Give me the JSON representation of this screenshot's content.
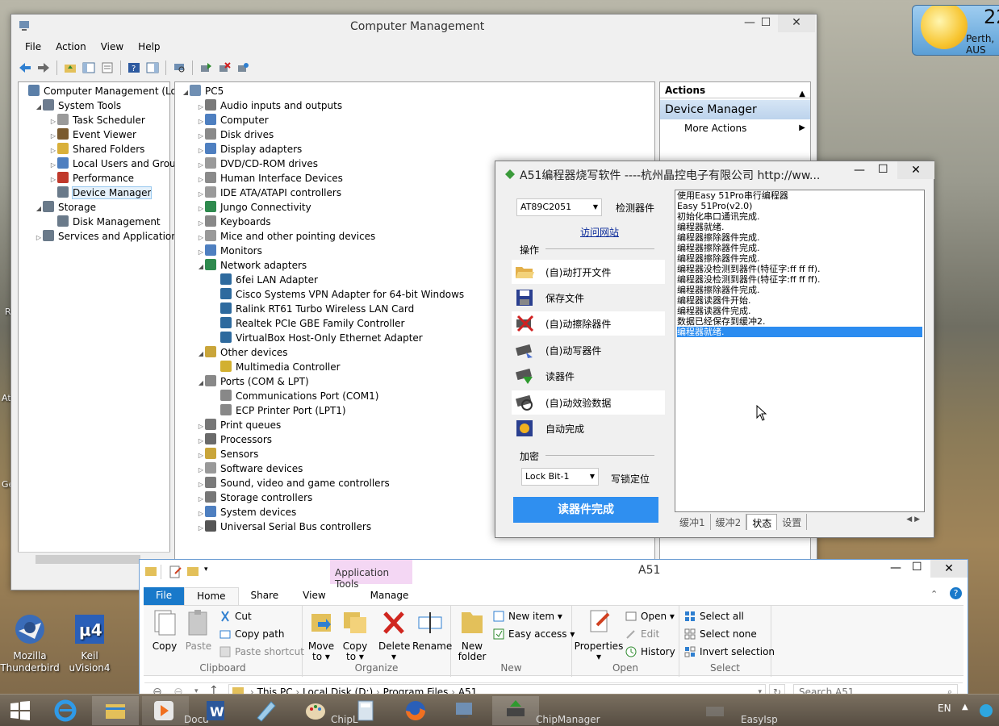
{
  "desktop": {
    "icons": [
      {
        "name": "Mozilla Thunderbird",
        "line1": "Mozilla",
        "line2": "Thunderbird"
      },
      {
        "name": "Keil uVision4",
        "line1": "Keil uVision4",
        "line2": ""
      }
    ],
    "edge_labels": [
      "R",
      "At",
      "Ge"
    ],
    "weather": {
      "temp": "22",
      "city": "Perth, AUS"
    }
  },
  "cm": {
    "title": "Computer Management",
    "menu": [
      "File",
      "Action",
      "View",
      "Help"
    ],
    "close": "✕",
    "minimize": "—",
    "maximize": "☐",
    "tree": [
      {
        "label": "Computer Management (Local",
        "level": 0,
        "tri": "",
        "icon": "#5b7fa8"
      },
      {
        "label": "System Tools",
        "level": 1,
        "tri": "◢",
        "icon": "#6d7c8f"
      },
      {
        "label": "Task Scheduler",
        "level": 2,
        "tri": "▷",
        "icon": "#9a9a9a"
      },
      {
        "label": "Event Viewer",
        "level": 2,
        "tri": "▷",
        "icon": "#7a5a2e"
      },
      {
        "label": "Shared Folders",
        "level": 2,
        "tri": "▷",
        "icon": "#d9b03a"
      },
      {
        "label": "Local Users and Groups",
        "level": 2,
        "tri": "▷",
        "icon": "#4e7fc0"
      },
      {
        "label": "Performance",
        "level": 2,
        "tri": "▷",
        "icon": "#c0392b"
      },
      {
        "label": "Device Manager",
        "level": 2,
        "tri": "",
        "icon": "#6a7a8a",
        "selected": true
      },
      {
        "label": "Storage",
        "level": 1,
        "tri": "◢",
        "icon": "#6a7a8a"
      },
      {
        "label": "Disk Management",
        "level": 2,
        "tri": "",
        "icon": "#6a7a8a"
      },
      {
        "label": "Services and Applications",
        "level": 1,
        "tri": "▷",
        "icon": "#6a7a8a"
      }
    ],
    "devices_root": "PC5",
    "devices": [
      {
        "label": "Audio inputs and outputs",
        "level": 1,
        "tri": "▷"
      },
      {
        "label": "Computer",
        "level": 1,
        "tri": "▷"
      },
      {
        "label": "Disk drives",
        "level": 1,
        "tri": "▷"
      },
      {
        "label": "Display adapters",
        "level": 1,
        "tri": "▷"
      },
      {
        "label": "DVD/CD-ROM drives",
        "level": 1,
        "tri": "▷"
      },
      {
        "label": "Human Interface Devices",
        "level": 1,
        "tri": "▷"
      },
      {
        "label": "IDE ATA/ATAPI controllers",
        "level": 1,
        "tri": "▷"
      },
      {
        "label": "Jungo Connectivity",
        "level": 1,
        "tri": "▷"
      },
      {
        "label": "Keyboards",
        "level": 1,
        "tri": "▷"
      },
      {
        "label": "Mice and other pointing devices",
        "level": 1,
        "tri": "▷"
      },
      {
        "label": "Monitors",
        "level": 1,
        "tri": "▷"
      },
      {
        "label": "Network adapters",
        "level": 1,
        "tri": "◢"
      },
      {
        "label": "6fei LAN Adapter",
        "level": 2,
        "tri": ""
      },
      {
        "label": "Cisco Systems VPN Adapter for 64-bit Windows",
        "level": 2,
        "tri": ""
      },
      {
        "label": "Ralink RT61 Turbo Wireless LAN Card",
        "level": 2,
        "tri": ""
      },
      {
        "label": "Realtek PCIe GBE Family Controller",
        "level": 2,
        "tri": ""
      },
      {
        "label": "VirtualBox Host-Only Ethernet Adapter",
        "level": 2,
        "tri": ""
      },
      {
        "label": "Other devices",
        "level": 1,
        "tri": "◢"
      },
      {
        "label": "Multimedia Controller",
        "level": 2,
        "tri": ""
      },
      {
        "label": "Ports (COM & LPT)",
        "level": 1,
        "tri": "◢"
      },
      {
        "label": "Communications Port (COM1)",
        "level": 2,
        "tri": ""
      },
      {
        "label": "ECP Printer Port (LPT1)",
        "level": 2,
        "tri": ""
      },
      {
        "label": "Print queues",
        "level": 1,
        "tri": "▷"
      },
      {
        "label": "Processors",
        "level": 1,
        "tri": "▷"
      },
      {
        "label": "Sensors",
        "level": 1,
        "tri": "▷"
      },
      {
        "label": "Software devices",
        "level": 1,
        "tri": "▷"
      },
      {
        "label": "Sound, video and game controllers",
        "level": 1,
        "tri": "▷"
      },
      {
        "label": "Storage controllers",
        "level": 1,
        "tri": "▷"
      },
      {
        "label": "System devices",
        "level": 1,
        "tri": "▷"
      },
      {
        "label": "Universal Serial Bus controllers",
        "level": 1,
        "tri": "▷"
      }
    ],
    "actions": {
      "header": "Actions",
      "section": "Device Manager",
      "more": "More Actions"
    }
  },
  "a51": {
    "title": "A51编程器烧写软件 ----杭州晶控电子有限公司 http://ww...",
    "chip": "AT89C2051",
    "detect": "检测器件",
    "website": "访问网站",
    "ops_label": "操作",
    "buttons": [
      "(自)动打开文件",
      "保存文件",
      "(自)动擦除器件",
      "(自)动写器件",
      "读器件",
      "(自)动效验数据",
      "自动完成"
    ],
    "encrypt_label": "加密",
    "lock": "Lock Bit-1",
    "lock_write": "写锁定位",
    "status_button": "读器件完成",
    "log": [
      "使用Easy 51Pro串行编程器",
      "Easy 51Pro(v2.0)",
      "初始化串口通讯完成.",
      "编程器就绪.",
      "编程器擦除器件完成.",
      "编程器擦除器件完成.",
      "编程器擦除器件完成.",
      "编程器没检测到器件(特征字:ff ff ff).",
      "编程器没检测到器件(特征字:ff ff ff).",
      "编程器擦除器件完成.",
      "编程器读器件开始.",
      "编程器读器件完成.",
      "数据已经保存到缓冲2.",
      "编程器就绪."
    ],
    "tabs": [
      "缓冲1",
      "缓冲2",
      "状态",
      "设置"
    ]
  },
  "explorer": {
    "title": "A51",
    "context_tab": "Application Tools",
    "tabs": [
      "File",
      "Home",
      "Share",
      "View",
      "Manage"
    ],
    "clipboard": {
      "copy": "Copy",
      "paste": "Paste",
      "cut": "Cut",
      "copy_path": "Copy path",
      "paste_shortcut": "Paste shortcut",
      "label": "Clipboard"
    },
    "organize": {
      "move_to_1": "Move",
      "move_to_2": "to ▾",
      "copy_to_1": "Copy",
      "copy_to_2": "to ▾",
      "delete": "Delete",
      "delete_2": "▾",
      "rename": "Rename",
      "label": "Organize"
    },
    "new": {
      "new_folder_1": "New",
      "new_folder_2": "folder",
      "new_item": "New item ▾",
      "easy_access": "Easy access ▾",
      "label": "New"
    },
    "open": {
      "properties": "Properties",
      "properties_2": "▾",
      "open": "Open ▾",
      "edit": "Edit",
      "history": "History",
      "label": "Open"
    },
    "select": {
      "all": "Select all",
      "none": "Select none",
      "invert": "Invert selection",
      "label": "Select"
    },
    "path": [
      "This PC",
      "Local Disk (D:)",
      "Program Files",
      "A51"
    ],
    "search_placeholder": "Search A51"
  },
  "taskbar": {
    "labels": [
      "Docu",
      "ChipL",
      "ChipManager",
      "EasyIsp"
    ],
    "lang": "EN"
  }
}
